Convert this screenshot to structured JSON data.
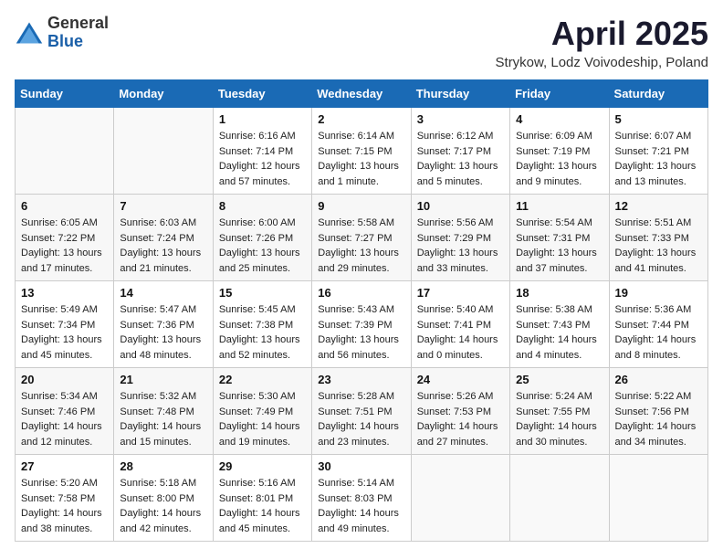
{
  "header": {
    "logo_general": "General",
    "logo_blue": "Blue",
    "month_year": "April 2025",
    "location": "Strykow, Lodz Voivodeship, Poland"
  },
  "weekdays": [
    "Sunday",
    "Monday",
    "Tuesday",
    "Wednesday",
    "Thursday",
    "Friday",
    "Saturday"
  ],
  "weeks": [
    [
      {
        "day": "",
        "info": ""
      },
      {
        "day": "",
        "info": ""
      },
      {
        "day": "1",
        "info": "Sunrise: 6:16 AM\nSunset: 7:14 PM\nDaylight: 12 hours\nand 57 minutes."
      },
      {
        "day": "2",
        "info": "Sunrise: 6:14 AM\nSunset: 7:15 PM\nDaylight: 13 hours\nand 1 minute."
      },
      {
        "day": "3",
        "info": "Sunrise: 6:12 AM\nSunset: 7:17 PM\nDaylight: 13 hours\nand 5 minutes."
      },
      {
        "day": "4",
        "info": "Sunrise: 6:09 AM\nSunset: 7:19 PM\nDaylight: 13 hours\nand 9 minutes."
      },
      {
        "day": "5",
        "info": "Sunrise: 6:07 AM\nSunset: 7:21 PM\nDaylight: 13 hours\nand 13 minutes."
      }
    ],
    [
      {
        "day": "6",
        "info": "Sunrise: 6:05 AM\nSunset: 7:22 PM\nDaylight: 13 hours\nand 17 minutes."
      },
      {
        "day": "7",
        "info": "Sunrise: 6:03 AM\nSunset: 7:24 PM\nDaylight: 13 hours\nand 21 minutes."
      },
      {
        "day": "8",
        "info": "Sunrise: 6:00 AM\nSunset: 7:26 PM\nDaylight: 13 hours\nand 25 minutes."
      },
      {
        "day": "9",
        "info": "Sunrise: 5:58 AM\nSunset: 7:27 PM\nDaylight: 13 hours\nand 29 minutes."
      },
      {
        "day": "10",
        "info": "Sunrise: 5:56 AM\nSunset: 7:29 PM\nDaylight: 13 hours\nand 33 minutes."
      },
      {
        "day": "11",
        "info": "Sunrise: 5:54 AM\nSunset: 7:31 PM\nDaylight: 13 hours\nand 37 minutes."
      },
      {
        "day": "12",
        "info": "Sunrise: 5:51 AM\nSunset: 7:33 PM\nDaylight: 13 hours\nand 41 minutes."
      }
    ],
    [
      {
        "day": "13",
        "info": "Sunrise: 5:49 AM\nSunset: 7:34 PM\nDaylight: 13 hours\nand 45 minutes."
      },
      {
        "day": "14",
        "info": "Sunrise: 5:47 AM\nSunset: 7:36 PM\nDaylight: 13 hours\nand 48 minutes."
      },
      {
        "day": "15",
        "info": "Sunrise: 5:45 AM\nSunset: 7:38 PM\nDaylight: 13 hours\nand 52 minutes."
      },
      {
        "day": "16",
        "info": "Sunrise: 5:43 AM\nSunset: 7:39 PM\nDaylight: 13 hours\nand 56 minutes."
      },
      {
        "day": "17",
        "info": "Sunrise: 5:40 AM\nSunset: 7:41 PM\nDaylight: 14 hours\nand 0 minutes."
      },
      {
        "day": "18",
        "info": "Sunrise: 5:38 AM\nSunset: 7:43 PM\nDaylight: 14 hours\nand 4 minutes."
      },
      {
        "day": "19",
        "info": "Sunrise: 5:36 AM\nSunset: 7:44 PM\nDaylight: 14 hours\nand 8 minutes."
      }
    ],
    [
      {
        "day": "20",
        "info": "Sunrise: 5:34 AM\nSunset: 7:46 PM\nDaylight: 14 hours\nand 12 minutes."
      },
      {
        "day": "21",
        "info": "Sunrise: 5:32 AM\nSunset: 7:48 PM\nDaylight: 14 hours\nand 15 minutes."
      },
      {
        "day": "22",
        "info": "Sunrise: 5:30 AM\nSunset: 7:49 PM\nDaylight: 14 hours\nand 19 minutes."
      },
      {
        "day": "23",
        "info": "Sunrise: 5:28 AM\nSunset: 7:51 PM\nDaylight: 14 hours\nand 23 minutes."
      },
      {
        "day": "24",
        "info": "Sunrise: 5:26 AM\nSunset: 7:53 PM\nDaylight: 14 hours\nand 27 minutes."
      },
      {
        "day": "25",
        "info": "Sunrise: 5:24 AM\nSunset: 7:55 PM\nDaylight: 14 hours\nand 30 minutes."
      },
      {
        "day": "26",
        "info": "Sunrise: 5:22 AM\nSunset: 7:56 PM\nDaylight: 14 hours\nand 34 minutes."
      }
    ],
    [
      {
        "day": "27",
        "info": "Sunrise: 5:20 AM\nSunset: 7:58 PM\nDaylight: 14 hours\nand 38 minutes."
      },
      {
        "day": "28",
        "info": "Sunrise: 5:18 AM\nSunset: 8:00 PM\nDaylight: 14 hours\nand 42 minutes."
      },
      {
        "day": "29",
        "info": "Sunrise: 5:16 AM\nSunset: 8:01 PM\nDaylight: 14 hours\nand 45 minutes."
      },
      {
        "day": "30",
        "info": "Sunrise: 5:14 AM\nSunset: 8:03 PM\nDaylight: 14 hours\nand 49 minutes."
      },
      {
        "day": "",
        "info": ""
      },
      {
        "day": "",
        "info": ""
      },
      {
        "day": "",
        "info": ""
      }
    ]
  ]
}
